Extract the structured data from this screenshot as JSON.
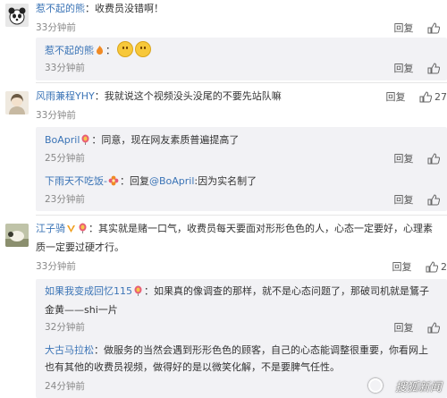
{
  "comments": [
    {
      "user": "惹不起的熊",
      "text": "：收费员没错啊！",
      "time": "33分钟前",
      "reply_label": "回复",
      "replies": [
        {
          "user": "惹不起的熊",
          "text": "：",
          "time": "33分钟前",
          "reply_label": "回复"
        }
      ]
    },
    {
      "user": "风雨兼程YHY",
      "text": "：我就说这个视频没头没尾的不要先站队嘛",
      "time": "33分钟前",
      "reply_label": "回复",
      "like_count": "27",
      "replies": [
        {
          "user": "BoApril",
          "text": "：同意，现在网友素质普遍提高了",
          "time": "25分钟前",
          "reply_label": "回复"
        },
        {
          "user": "下雨天不吃饭-",
          "text": "：回复",
          "mention": "@BoApril",
          "text2": ":因为实名制了",
          "time": "23分钟前",
          "reply_label": "回复"
        }
      ]
    },
    {
      "user": "江子骑",
      "text": "：其实就是赌一口气，收费员每天要面对形形色色的人，心态一定要好，心理素质一定要过硬才行。",
      "time": "33分钟前",
      "reply_label": "回复",
      "like_count": "2",
      "replies": [
        {
          "user": "如果我变成回忆115",
          "text": "：如果真的像调查的那样，就不是心态问题了，那破司机就是鵟子金黄——shi一片",
          "time": "32分钟前",
          "reply_label": "回复"
        },
        {
          "user": "大古马拉松",
          "text": "：做服务的当然会遇到形形色色的顾客，自己的心态能调整很重要，你看网上也有其他的收费员视频，做得好的是以微笑化解，不是要脾气任性。",
          "time": "24分钟前",
          "reply_label": "回复"
        }
      ]
    }
  ],
  "watermark": "搜狐新闻",
  "colors": {
    "username": "#3b74b6",
    "time": "#888888",
    "reply_bg": "#f2f2f5"
  }
}
